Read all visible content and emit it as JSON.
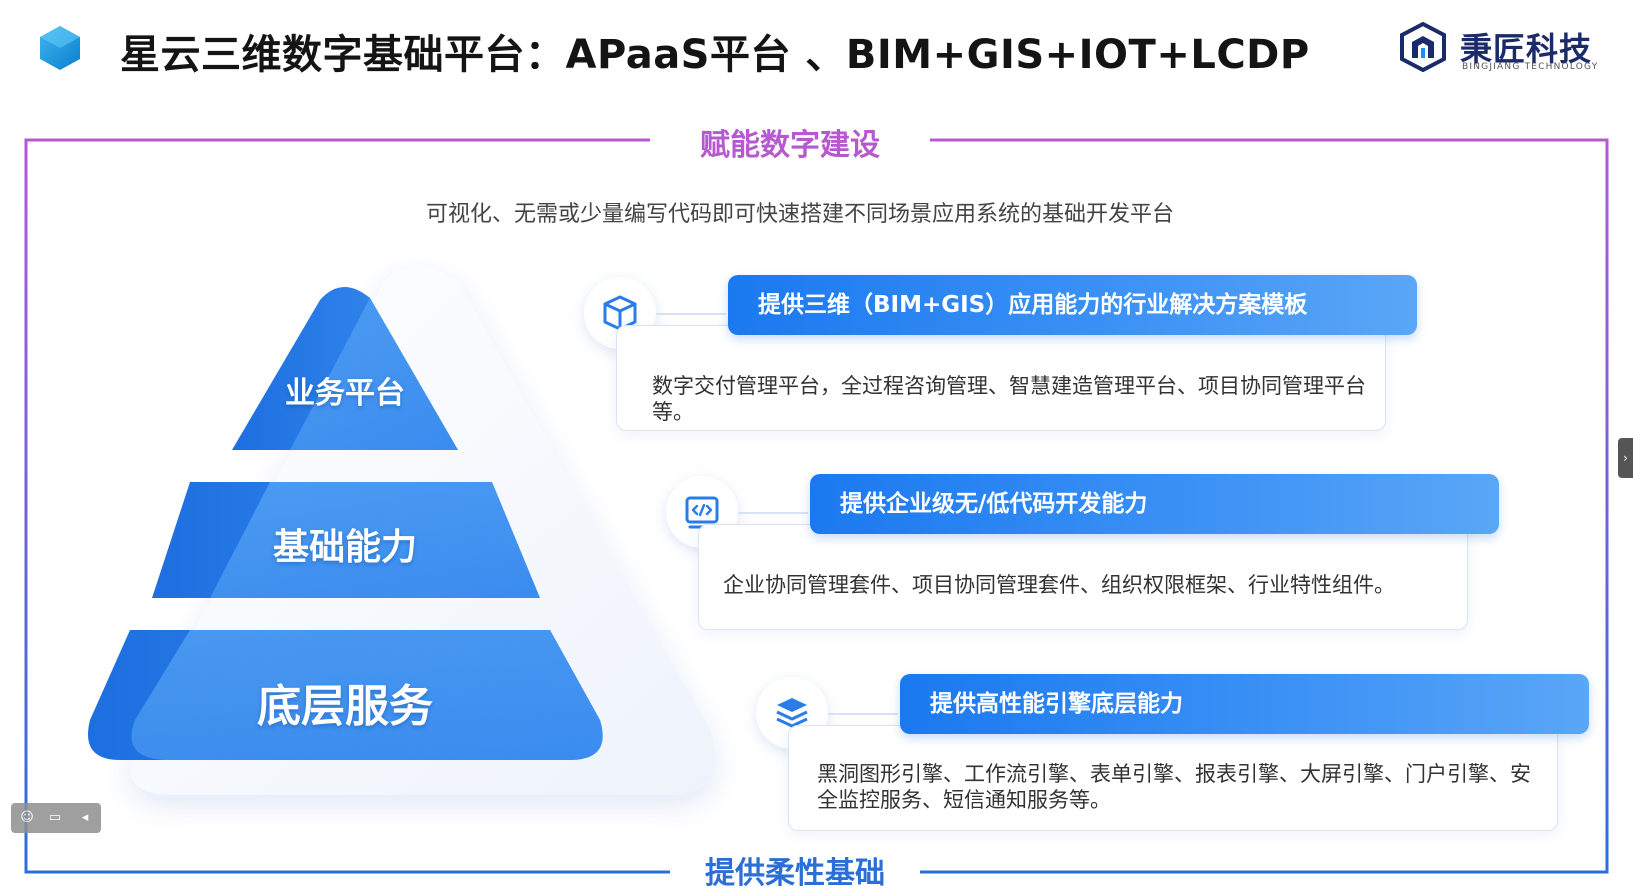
{
  "header": {
    "title": "星云三维数字基础平台：APaaS平台 、BIM+GIS+IOT+LCDP",
    "brand_name": "秉匠科技",
    "brand_sub": "BINGJIANG TECHNOLOGY"
  },
  "frame": {
    "top_label": "赋能数字建设",
    "bottom_label": "提供柔性基础",
    "subtitle": "可视化、无需或少量编写代码即可快速搭建不同场景应用系统的基础开发平台"
  },
  "pyramid": {
    "levels": [
      {
        "label": "业务平台"
      },
      {
        "label": "基础能力"
      },
      {
        "label": "底层服务"
      }
    ]
  },
  "features": [
    {
      "icon": "cube-icon",
      "title": "提供三维（BIM+GIS）应用能力的行业解决方案模板",
      "desc": "数字交付管理平台，全过程咨询管理、智慧建造管理平台、项目协同管理平台等。"
    },
    {
      "icon": "code-icon",
      "title": "提供企业级无/低代码开发能力",
      "desc": "企业协同管理套件、项目协同管理套件、组织权限框架、行业特性组件。"
    },
    {
      "icon": "layers-icon",
      "title": "提供高性能引擎底层能力",
      "desc": "黑洞图形引擎、工作流引擎、表单引擎、报表引擎、大屏引擎、门户引擎、安全监控服务、短信通知服务等。"
    }
  ],
  "colors": {
    "accent_blue": "#1b79f0",
    "frame_purple": "#b659d0",
    "frame_blue": "#2b6fd6"
  }
}
